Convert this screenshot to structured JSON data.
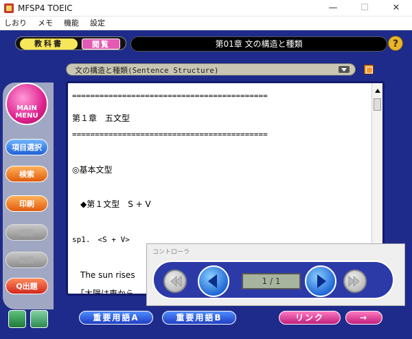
{
  "window": {
    "title": "MFSP4 TOEIC",
    "minimize": "—",
    "maximize": "☐",
    "close": "✕"
  },
  "menu": [
    "しおり",
    "メモ",
    "機能",
    "設定"
  ],
  "toolbar": {
    "tab_kyokasho": "教科書",
    "tab_etsuran": "閲覧",
    "chapter": "第01章 文の構造と種類",
    "help": "?"
  },
  "section": {
    "title": "文の構造と種類(Sentence Structure)"
  },
  "sidebar": {
    "main_menu_1": "MAIN",
    "main_menu_2": "MENU",
    "item_select": "項目選択",
    "search": "検索",
    "print": "印刷",
    "disabled1": "閲覧",
    "disabled2": "閲覧",
    "quiz": "Q出題"
  },
  "content": {
    "lines": [
      "===========================================",
      "第１章　五文型",
      "===========================================",
      "◎基本文型",
      "　◆第１文型　S + V",
      "sp1.　<S + V>",
      "　The sun rises",
      "　「太陽は東から"
    ]
  },
  "controller": {
    "title": "コントローラ",
    "counter": "1 / 1"
  },
  "bottom": {
    "btn_a": "重要用語A",
    "btn_b": "重要用語B",
    "link": "リンク",
    "next": "→"
  }
}
